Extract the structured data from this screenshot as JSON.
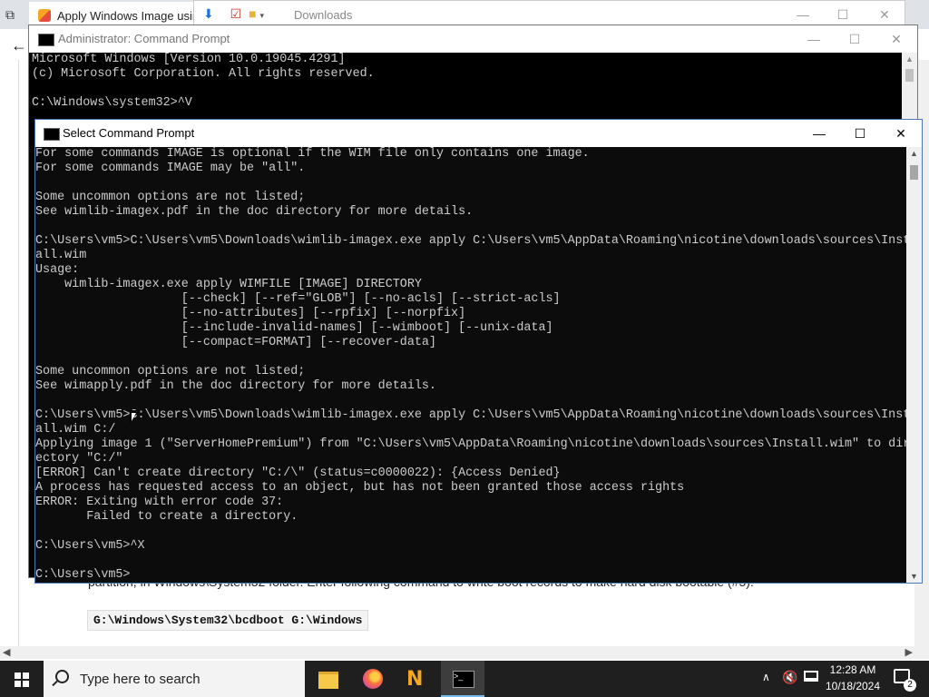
{
  "browser": {
    "tab_title": "Apply Windows Image using",
    "page_text": "partition, in Windows\\System32 folder. Enter following command to write boot records to make hard disk bootable (#5):",
    "code_line": "G:\\Windows\\System32\\bcdboot G:\\Windows"
  },
  "explorer": {
    "title": "Downloads"
  },
  "cmd_admin": {
    "title": "Administrator: Command Prompt",
    "lines": "Microsoft Windows [Version 10.0.19045.4291]\n(c) Microsoft Corporation. All rights reserved.\n\nC:\\Windows\\system32>^V"
  },
  "cmd_select": {
    "title": "Select Command Prompt",
    "lines": "For some commands IMAGE is optional if the WIM file only contains one image.\nFor some commands IMAGE may be \"all\".\n\nSome uncommon options are not listed;\nSee wimlib-imagex.pdf in the doc directory for more details.\n\nC:\\Users\\vm5>C:\\Users\\vm5\\Downloads\\wimlib-imagex.exe apply C:\\Users\\vm5\\AppData\\Roaming\\nicotine\\downloads\\sources\\Inst\nall.wim\nUsage:\n    wimlib-imagex.exe apply WIMFILE [IMAGE] DIRECTORY\n                    [--check] [--ref=\"GLOB\"] [--no-acls] [--strict-acls]\n                    [--no-attributes] [--rpfix] [--norpfix]\n                    [--include-invalid-names] [--wimboot] [--unix-data]\n                    [--compact=FORMAT] [--recover-data]\n\nSome uncommon options are not listed;\nSee wimapply.pdf in the doc directory for more details.\n\nC:\\Users\\vm5>C:\\Users\\vm5\\Downloads\\wimlib-imagex.exe apply C:\\Users\\vm5\\AppData\\Roaming\\nicotine\\downloads\\sources\\Inst\nall.wim C:/\nApplying image 1 (\"ServerHomePremium\") from \"C:\\Users\\vm5\\AppData\\Roaming\\nicotine\\downloads\\sources\\Install.wim\" to dir\nectory \"C:/\"\n[ERROR] Can't create directory \"C:/\\\" (status=c0000022): {Access Denied}\nA process has requested access to an object, but has not been granted those access rights\nERROR: Exiting with error code 37:\n       Failed to create a directory.\n\nC:\\Users\\vm5>^X\n\nC:\\Users\\vm5>"
  },
  "window_controls": {
    "minimize": "—",
    "maximize": "☐",
    "close": "✕"
  },
  "taskbar": {
    "search_placeholder": "Type here to search",
    "time": "12:28 AM",
    "date": "10/18/2024",
    "notification_count": "2"
  }
}
